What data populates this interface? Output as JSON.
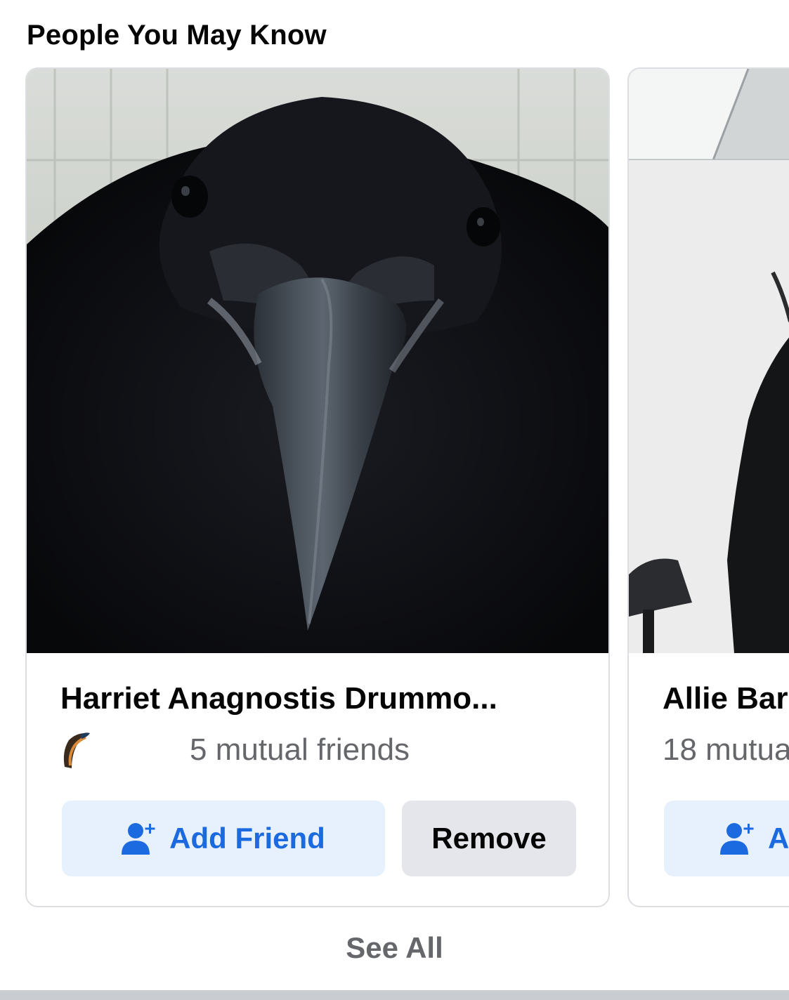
{
  "section": {
    "title": "People You May Know"
  },
  "cards": [
    {
      "name": "Harriet Anagnostis Drummo...",
      "mutual_text": "5 mutual friends",
      "add_label": "Add Friend",
      "remove_label": "Remove",
      "photo_icon": "crow-photo"
    },
    {
      "name": "Allie Bar",
      "mutual_text": "18 mutua",
      "add_label": "Ad",
      "photo_icon": "person-photo"
    }
  ],
  "footer": {
    "see_all_label": "See All"
  },
  "colors": {
    "accent": "#1b6ae0",
    "add_button_bg": "#e7f0fd",
    "remove_button_bg": "#e4e6eb",
    "secondary_text": "#65676b"
  }
}
